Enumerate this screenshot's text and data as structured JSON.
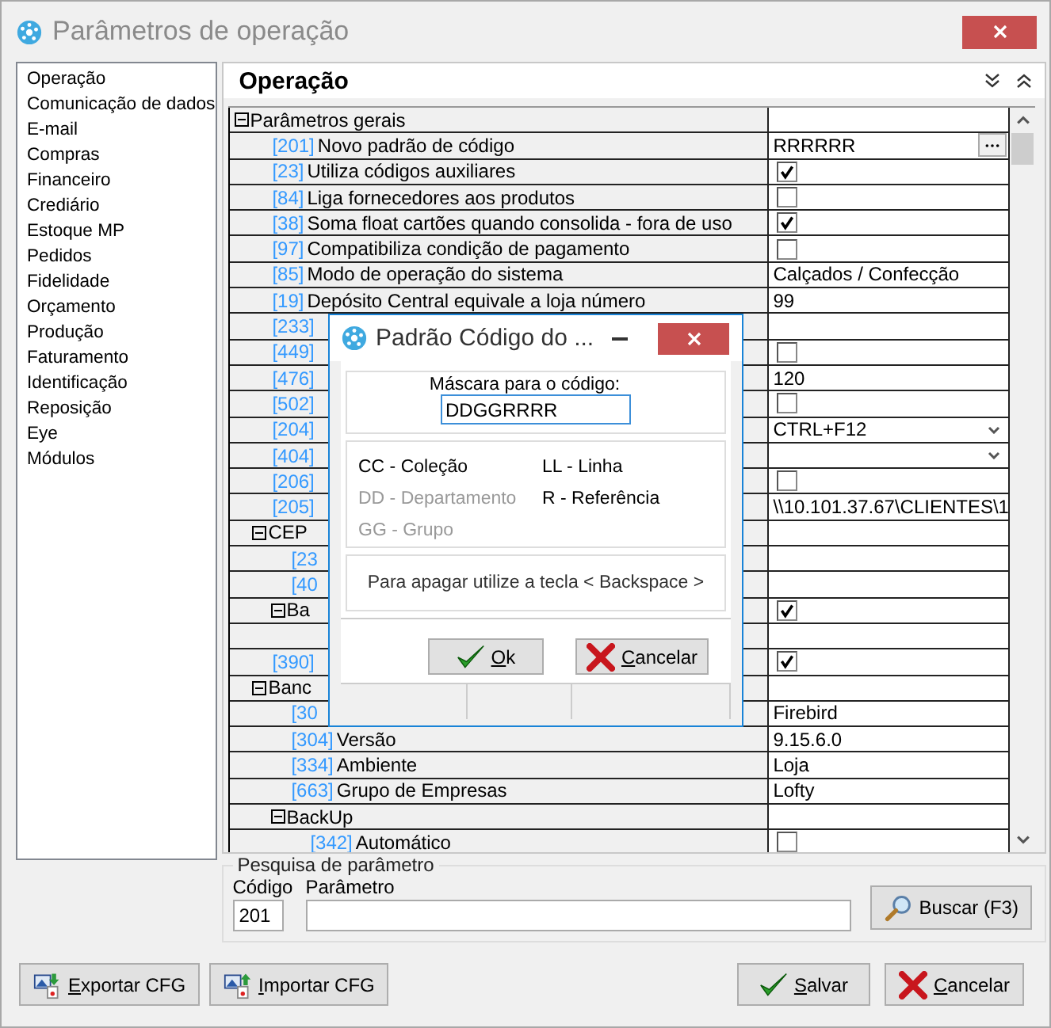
{
  "window": {
    "title": "Parâmetros de operação"
  },
  "sidebar": {
    "items": [
      "Operação",
      "Comunicação de dados",
      "E-mail",
      "Compras",
      "Financeiro",
      "Crediário",
      "Estoque MP",
      "Pedidos",
      "Fidelidade",
      "Orçamento",
      "Produção",
      "Faturamento",
      "Identificação",
      "Reposição",
      "Eye",
      "Módulos"
    ]
  },
  "panel": {
    "title": "Operação"
  },
  "grid": {
    "rows": [
      {
        "kind": "group",
        "label": "Parâmetros gerais",
        "expanded": true,
        "children": [
          {
            "kind": "item",
            "code": "[201]",
            "label": "Novo padrão de código",
            "value": {
              "kind": "edit",
              "text": "RRRRRR"
            }
          },
          {
            "kind": "item",
            "code": "[23]",
            "label": "Utiliza códigos auxiliares",
            "value": {
              "kind": "check",
              "checked": true
            }
          },
          {
            "kind": "item",
            "code": "[84]",
            "label": "Liga fornecedores aos produtos",
            "value": {
              "kind": "check",
              "checked": false
            }
          },
          {
            "kind": "item",
            "code": "[38]",
            "label": "Soma float cartões quando consolida - fora de uso",
            "value": {
              "kind": "check",
              "checked": true
            }
          },
          {
            "kind": "item",
            "code": "[97]",
            "label": "Compatibiliza condição de pagamento",
            "value": {
              "kind": "check",
              "checked": false
            }
          },
          {
            "kind": "item",
            "code": "[85]",
            "label": "Modo de operação do sistema",
            "value": {
              "kind": "text",
              "text": "Calçados / Confecção"
            }
          },
          {
            "kind": "item",
            "code": "[19]",
            "label": "Depósito Central equivale a loja número",
            "value": {
              "kind": "text",
              "text": "99"
            }
          },
          {
            "kind": "item",
            "code": "[233]"
          },
          {
            "kind": "item",
            "code": "[449]",
            "value": {
              "kind": "check",
              "checked": false
            }
          },
          {
            "kind": "item",
            "code": "[476]",
            "value": {
              "kind": "text",
              "text": "120"
            }
          },
          {
            "kind": "item",
            "code": "[502]",
            "value": {
              "kind": "check",
              "checked": false
            }
          },
          {
            "kind": "item",
            "code": "[204]",
            "value": {
              "kind": "dropdown",
              "text": "CTRL+F12"
            }
          },
          {
            "kind": "item",
            "code": "[404]",
            "value": {
              "kind": "dropdown"
            }
          },
          {
            "kind": "item",
            "code": "[206]",
            "value": {
              "kind": "check",
              "checked": false
            }
          },
          {
            "kind": "item",
            "code": "[205]",
            "value": {
              "kind": "text",
              "text": "\\\\10.101.37.67\\CLIENTES\\1"
            }
          },
          {
            "kind": "group",
            "label": "CEP",
            "expanded": true,
            "children": [
              {
                "kind": "item",
                "code": "[23"
              },
              {
                "kind": "item",
                "code": "[40"
              },
              {
                "kind": "group",
                "label": "Ba",
                "expanded": true,
                "value": {
                  "kind": "check",
                  "checked": true
                },
                "children": [
                  {
                    "kind": "covered"
                  }
                ]
              }
            ]
          },
          {
            "kind": "item",
            "code": "[390]",
            "value": {
              "kind": "check",
              "checked": true
            }
          },
          {
            "kind": "group",
            "label": "Banc",
            "expanded": true,
            "children": [
              {
                "kind": "item",
                "code": "[30",
                "value": {
                  "kind": "text",
                  "text": "Firebird"
                }
              },
              {
                "kind": "item",
                "code": "[304]",
                "label": "Versão",
                "value": {
                  "kind": "text",
                  "text": " 9.15.6.0"
                }
              },
              {
                "kind": "item",
                "code": "[334]",
                "label": "Ambiente",
                "value": {
                  "kind": "text",
                  "text": "Loja"
                }
              },
              {
                "kind": "item",
                "code": "[663]",
                "label": "Grupo de Empresas",
                "value": {
                  "kind": "text",
                  "text": "Lofty"
                }
              },
              {
                "kind": "group",
                "label": "BackUp",
                "expanded": true,
                "children": [
                  {
                    "kind": "item",
                    "code": "[342]",
                    "label": "Automático",
                    "value": {
                      "kind": "check",
                      "checked": false
                    }
                  }
                ]
              }
            ]
          }
        ]
      }
    ]
  },
  "search": {
    "legend": "Pesquisa de parâmetro",
    "code_label": "Código",
    "code_value": "201",
    "param_label": "Parâmetro",
    "button": "Buscar (F3)"
  },
  "footer": {
    "buttons": [
      {
        "kind": "export",
        "label": "Exportar CFG"
      },
      {
        "kind": "import",
        "label": "Importar CFG"
      },
      {
        "kind": "save",
        "label": "Salvar"
      },
      {
        "kind": "cancel",
        "label": "Cancelar"
      }
    ]
  },
  "dialog": {
    "title": "Padrão Código do ...",
    "mask_label": "Máscara para o código:",
    "mask_value": "DDGGRRRR",
    "legend": [
      {
        "text": "CC - Coleção",
        "disabled": false
      },
      {
        "text": "LL - Linha",
        "disabled": false
      },
      {
        "text": "DD - Departamento",
        "disabled": true
      },
      {
        "text": "R - Referência",
        "disabled": false
      },
      {
        "text": "GG - Grupo",
        "disabled": true
      }
    ],
    "hint": "Para apagar utilize a tecla < Backspace >",
    "buttons": [
      {
        "kind": "ok",
        "label": "Ok"
      },
      {
        "kind": "cancel",
        "label": "Cancelar"
      }
    ]
  }
}
